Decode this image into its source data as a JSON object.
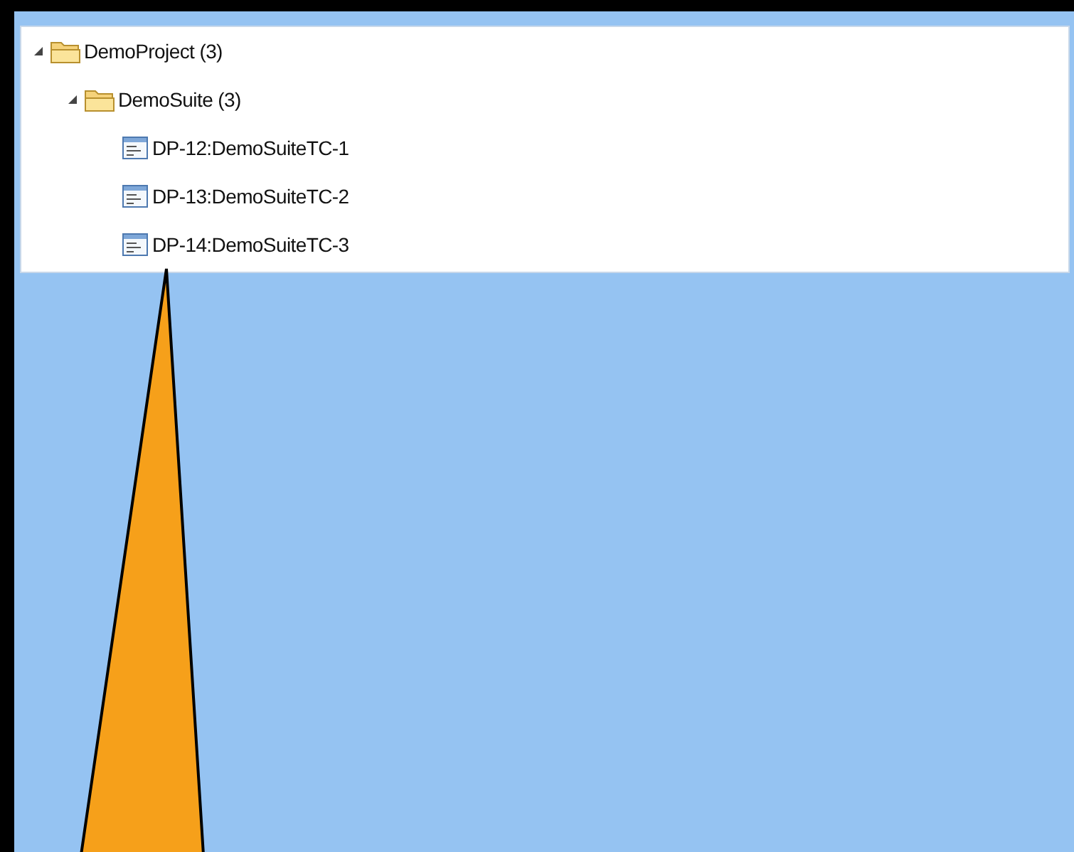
{
  "tree": [
    {
      "kind": "folder",
      "label": "DemoProject (3)",
      "expanded": true,
      "children": [
        {
          "kind": "folder",
          "label": "DemoSuite (3)",
          "expanded": true,
          "children": [
            {
              "kind": "test",
              "label": "DP-12:DemoSuiteTC-1"
            },
            {
              "kind": "test",
              "label": "DP-13:DemoSuiteTC-2"
            },
            {
              "kind": "test",
              "label": "DP-14:DemoSuiteTC-3"
            }
          ]
        }
      ]
    }
  ]
}
